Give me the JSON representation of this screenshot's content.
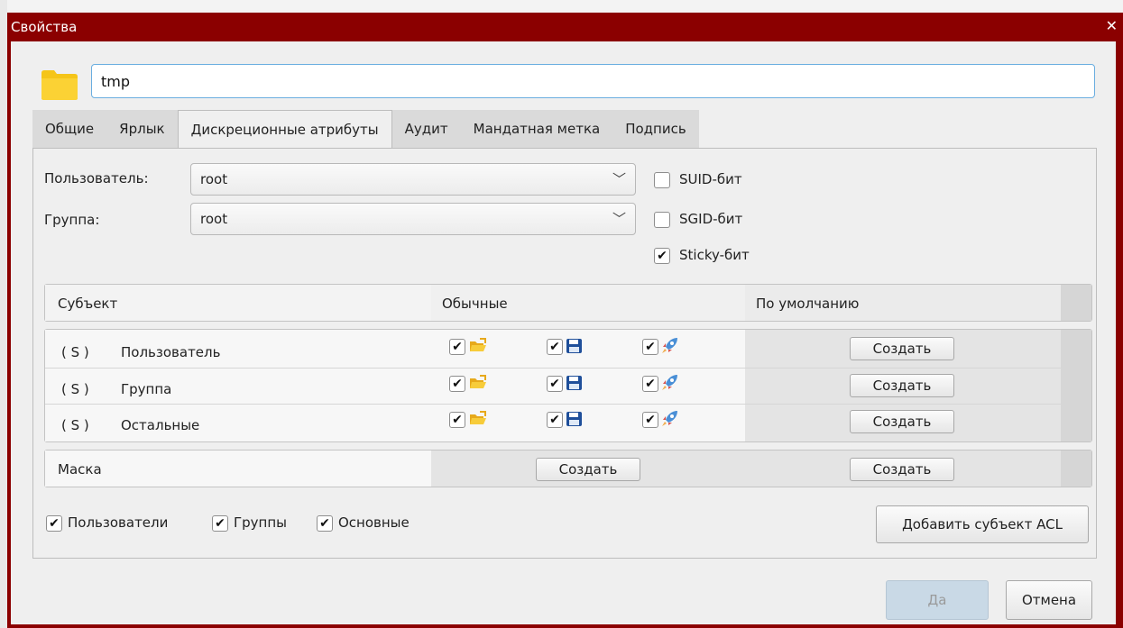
{
  "window": {
    "title": "Свойства",
    "close_glyph": "✕"
  },
  "name_field": {
    "value": "tmp",
    "icon": "folder-icon"
  },
  "tabs": [
    {
      "label": "Общие"
    },
    {
      "label": "Ярлык"
    },
    {
      "label": "Дискреционные атрибуты",
      "active": true
    },
    {
      "label": "Аудит"
    },
    {
      "label": "Мандатная метка"
    },
    {
      "label": "Подпись"
    }
  ],
  "owner": {
    "label": "Пользователь:",
    "value": "root"
  },
  "group": {
    "label": "Группа:",
    "value": "root"
  },
  "special_bits": [
    {
      "label": "SUID-бит",
      "checked": false
    },
    {
      "label": "SGID-бит",
      "checked": false
    },
    {
      "label": "Sticky-бит",
      "checked": true
    }
  ],
  "acl_table": {
    "headers": {
      "subject": "Субъект",
      "normal": "Обычные",
      "default": "По умолчанию"
    },
    "rows": [
      {
        "prefix": "( S )",
        "subject": "Пользователь",
        "read": true,
        "write": true,
        "exec": true,
        "default_button": "Создать"
      },
      {
        "prefix": "( S )",
        "subject": "Группа",
        "read": true,
        "write": true,
        "exec": true,
        "default_button": "Создать"
      },
      {
        "prefix": "( S )",
        "subject": "Остальные",
        "read": true,
        "write": true,
        "exec": true,
        "default_button": "Создать"
      }
    ],
    "mask": {
      "label": "Маска",
      "normal_button": "Создать",
      "default_button": "Создать"
    }
  },
  "filters": [
    {
      "label": "Пользователи",
      "checked": true
    },
    {
      "label": "Группы",
      "checked": true
    },
    {
      "label": "Основные",
      "checked": true
    }
  ],
  "add_acl_button": "Добавить субъект ACL",
  "footer": {
    "ok": "Да",
    "cancel": "Отмена"
  },
  "colors": {
    "title_bar": "#8b0000",
    "focus": "#6aaee0",
    "read_icon": "#f2c232",
    "write_icon": "#1f4f9a",
    "exec_icon": "#4a8fd6"
  },
  "permission_icons": {
    "read": "open-folder-icon",
    "write": "floppy-disk-icon",
    "exec": "rocket-icon"
  }
}
